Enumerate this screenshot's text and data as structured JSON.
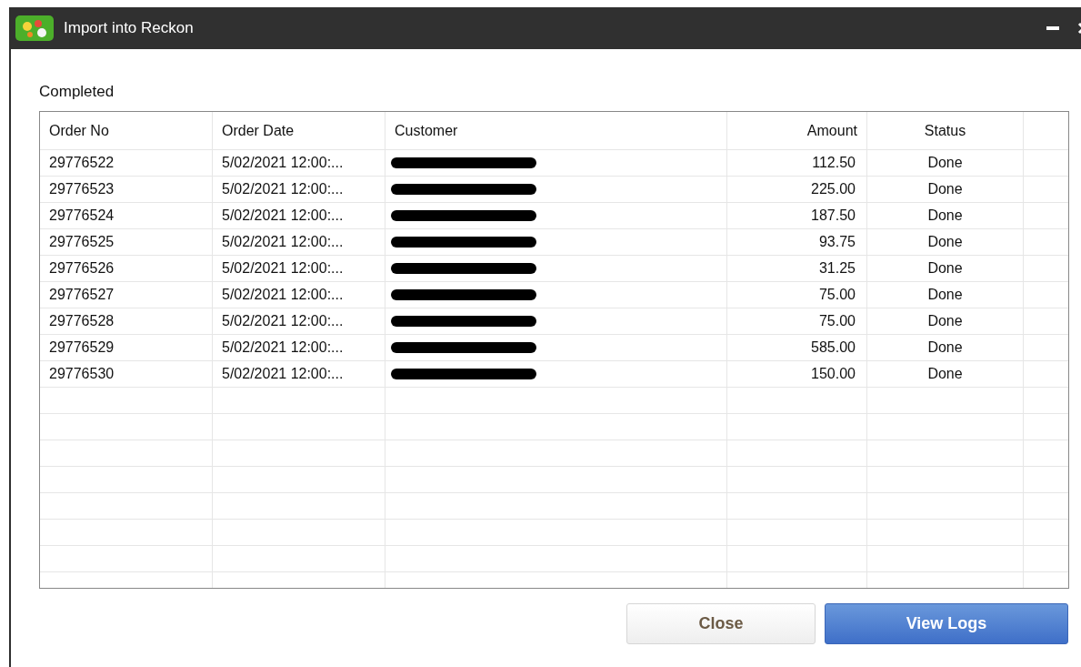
{
  "window": {
    "title": "Import into Reckon"
  },
  "heading": "Completed",
  "table": {
    "columns": [
      "Order No",
      "Order Date",
      "Customer",
      "Amount",
      "Status"
    ],
    "rows": [
      {
        "order_no": "29776522",
        "order_date": "5/02/2021 12:00:...",
        "customer_redacted": true,
        "amount": "112.50",
        "status": "Done"
      },
      {
        "order_no": "29776523",
        "order_date": "5/02/2021 12:00:...",
        "customer_redacted": true,
        "amount": "225.00",
        "status": "Done"
      },
      {
        "order_no": "29776524",
        "order_date": "5/02/2021 12:00:...",
        "customer_redacted": true,
        "amount": "187.50",
        "status": "Done"
      },
      {
        "order_no": "29776525",
        "order_date": "5/02/2021 12:00:...",
        "customer_redacted": true,
        "amount": "93.75",
        "status": "Done"
      },
      {
        "order_no": "29776526",
        "order_date": "5/02/2021 12:00:...",
        "customer_redacted": true,
        "amount": "31.25",
        "status": "Done"
      },
      {
        "order_no": "29776527",
        "order_date": "5/02/2021 12:00:...",
        "customer_redacted": true,
        "amount": "75.00",
        "status": "Done"
      },
      {
        "order_no": "29776528",
        "order_date": "5/02/2021 12:00:...",
        "customer_redacted": true,
        "amount": "75.00",
        "status": "Done"
      },
      {
        "order_no": "29776529",
        "order_date": "5/02/2021 12:00:...",
        "customer_redacted": true,
        "amount": "585.00",
        "status": "Done"
      },
      {
        "order_no": "29776530",
        "order_date": "5/02/2021 12:00:...",
        "customer_redacted": true,
        "amount": "150.00",
        "status": "Done"
      }
    ]
  },
  "buttons": [
    {
      "label": "Close",
      "kind": "default"
    },
    {
      "label": "View Logs",
      "kind": "primary"
    }
  ]
}
